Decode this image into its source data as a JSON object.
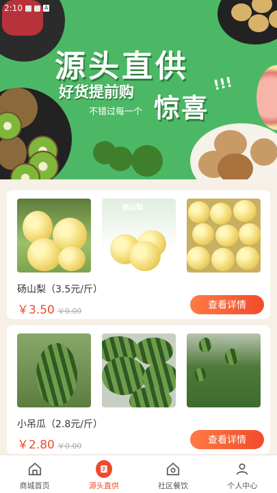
{
  "status_bar": {
    "time": "2:10"
  },
  "banner": {
    "title": "源头直供",
    "subtitle": "好货提前购",
    "tagline": "不错过每一个",
    "highlight": "惊喜",
    "exclaim": "!!!"
  },
  "products": [
    {
      "name": "砀山梨（3.5元/斤）",
      "price": "￥3.50",
      "original_price": "￥0.00",
      "button_label": "查看详情",
      "image_text": "砀山梨"
    },
    {
      "name": "小吊瓜（2.8元/斤）",
      "price": "￥2.80",
      "original_price": "￥0.00",
      "button_label": "查看详情"
    }
  ],
  "tabbar": {
    "active_color": "#f04a2a",
    "items": [
      {
        "label": "商城首页",
        "icon": "home-icon"
      },
      {
        "label": "源头直供",
        "icon": "source-direct-icon",
        "active": true
      },
      {
        "label": "社区餐饮",
        "icon": "community-dining-icon"
      },
      {
        "label": "个人中心",
        "icon": "user-icon"
      }
    ]
  }
}
